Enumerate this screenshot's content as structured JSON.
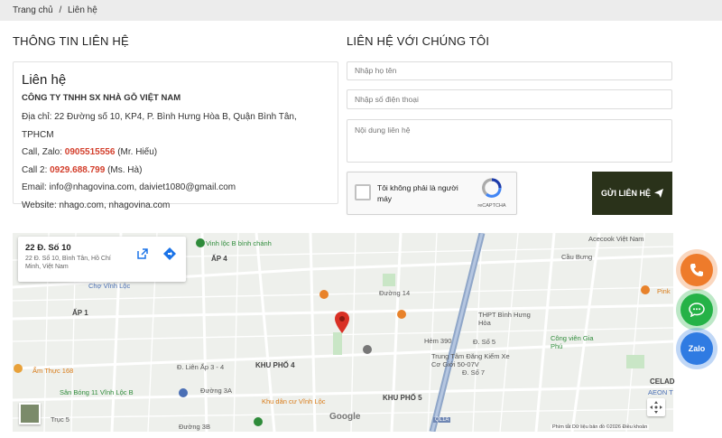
{
  "breadcrumb": {
    "home": "Trang chủ",
    "sep": "/",
    "current": "Liên hệ"
  },
  "left": {
    "section_title": "THÔNG TIN LIÊN HỆ",
    "box_title": "Liên hệ",
    "company": "CÔNG TY TNHH SX NHÀ GỖ VIỆT NAM",
    "address": "Địa chỉ: 22 Đường số 10, KP4, P. Bình Hưng Hòa B, Quận Bình Tân, TPHCM",
    "call1_prefix": "Call, Zalo: ",
    "call1_number": "0905515556",
    "call1_suffix": " (Mr. Hiếu)",
    "call2_prefix": "Call 2: ",
    "call2_number": "0929.688.799",
    "call2_suffix": " (Ms. Hà)",
    "email": "Email: info@nhagovina.com, daiviet1080@gmail.com",
    "website": "Website: nhago.com, nhagovina.com"
  },
  "right": {
    "section_title": "LIÊN HỆ VỚI CHÚNG TÔI",
    "name_placeholder": "Nhập họ tên",
    "phone_placeholder": "Nhập số điện thoại",
    "content_placeholder": "Nội dung liên hệ",
    "captcha_text": "Tôi không phải là người máy",
    "captcha_brand": "reCAPTCHA",
    "submit_label": "GỬI LIÊN HỆ"
  },
  "map": {
    "card_title": "22 Đ. Số 10",
    "card_sub": "22 Đ. Số 10, Bình Tân, Hồ Chí Minh, Việt Nam",
    "labels": [
      {
        "text": "Vinh lộc B bình chánh",
        "cls": "lbl-green"
      },
      {
        "text": "ẤP 4",
        "cls": "lbl-strong"
      },
      {
        "text": "Chợ Vĩnh Lộc",
        "cls": "lbl-blue"
      },
      {
        "text": "ẤP 1",
        "cls": "lbl-strong"
      },
      {
        "text": "Ẩm Thực 168",
        "cls": "lbl-orange"
      },
      {
        "text": "Sân Bóng 11 Vĩnh Lộc B",
        "cls": "lbl-green"
      },
      {
        "text": "Đường 3A",
        "cls": ""
      },
      {
        "text": "KHU PHỐ 4",
        "cls": "lbl-strong"
      },
      {
        "text": "Khu dân cư Vĩnh Lộc",
        "cls": "lbl-orange"
      },
      {
        "text": "KHU PHỐ 5",
        "cls": "lbl-strong"
      },
      {
        "text": "THPT Bình Hưng Hòa",
        "cls": ""
      },
      {
        "text": "Trung Tâm Đăng Kiểm Xe Cơ Giới 50-07V",
        "cls": ""
      },
      {
        "text": "Công viên Gia Phú",
        "cls": "lbl-green"
      },
      {
        "text": "Acecook Việt Nam",
        "cls": ""
      },
      {
        "text": "Cầu Bưng",
        "cls": ""
      },
      {
        "text": "Pink",
        "cls": "lbl-orange"
      },
      {
        "text": "CELAD",
        "cls": "lbl-strong"
      },
      {
        "text": "AEON T",
        "cls": "lbl-blue"
      },
      {
        "text": "Trục 5",
        "cls": ""
      },
      {
        "text": "Đường 3B",
        "cls": ""
      },
      {
        "text": "Hẻm 390",
        "cls": ""
      },
      {
        "text": "Đường 14",
        "cls": ""
      },
      {
        "text": "Đ. Liên Ấp 3 - 4",
        "cls": ""
      },
      {
        "text": "Đ. Số 5",
        "cls": ""
      },
      {
        "text": "Đ. Số 7",
        "cls": ""
      },
      {
        "text": "QL1A",
        "cls": ""
      }
    ],
    "google": "Google",
    "footer": "Phím tắt   Dữ liệu bản đồ ©2026   Điều khoản"
  },
  "floating": {
    "zalo": "Zalo"
  }
}
